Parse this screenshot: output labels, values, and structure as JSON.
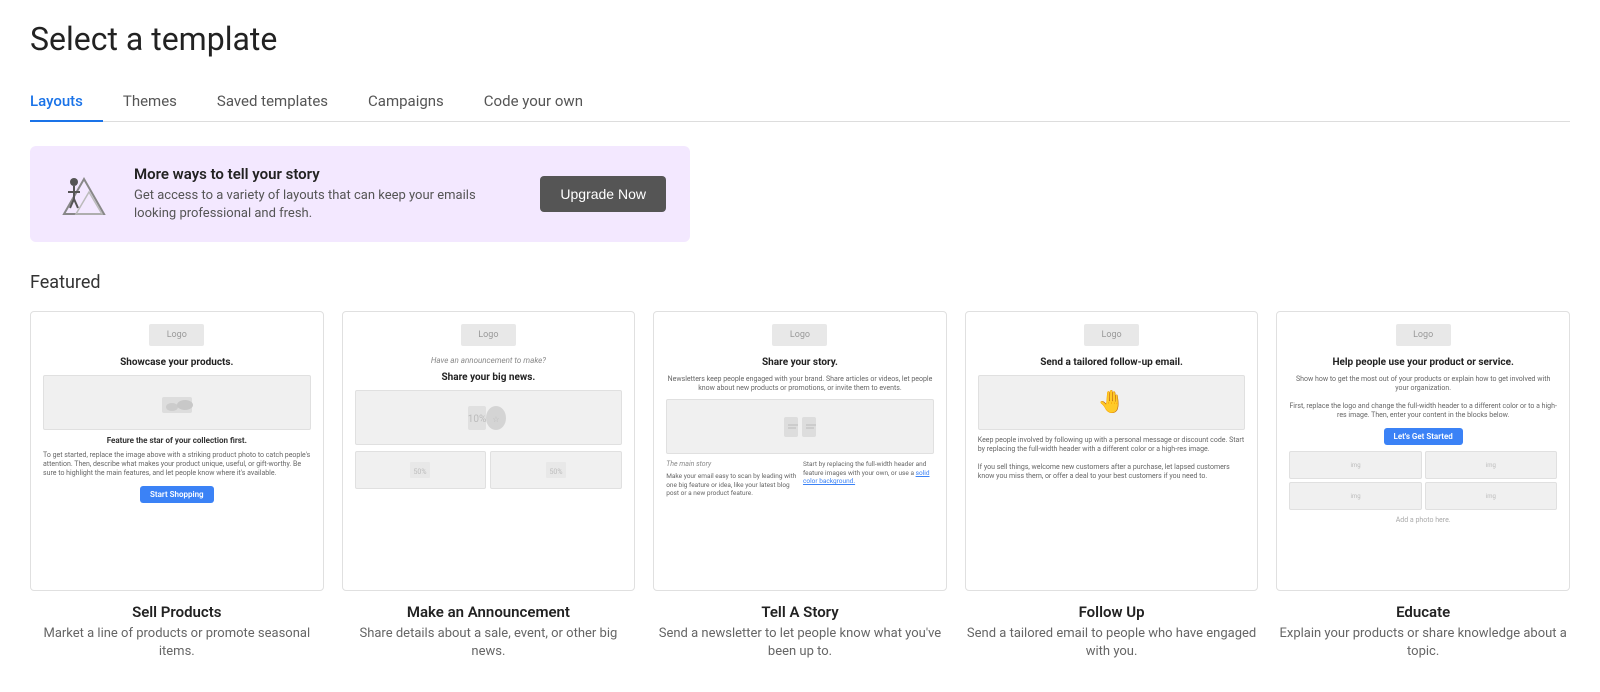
{
  "page": {
    "title": "Select a template"
  },
  "tabs": [
    {
      "id": "layouts",
      "label": "Layouts",
      "active": true
    },
    {
      "id": "themes",
      "label": "Themes",
      "active": false
    },
    {
      "id": "saved-templates",
      "label": "Saved templates",
      "active": false
    },
    {
      "id": "campaigns",
      "label": "Campaigns",
      "active": false
    },
    {
      "id": "code-your-own",
      "label": "Code your own",
      "active": false
    }
  ],
  "banner": {
    "title": "More ways to tell your story",
    "description": "Get access to a variety of layouts that can keep your emails looking professional and fresh.",
    "button_label": "Upgrade Now"
  },
  "featured_section": {
    "label": "Featured"
  },
  "templates": [
    {
      "id": "sell-products",
      "name": "Sell Products",
      "description": "Market a line of products or promote seasonal items.",
      "preview_headline": "Showcase your products.",
      "preview_subtext": "Feature the star of your collection first.",
      "preview_body": "To get started, replace the image above with a striking product photo to catch people's attention. Then, describe what makes your product unique, useful, or gift-worthy.",
      "preview_btn_label": "Start Shopping",
      "preview_btn_color": "#3b82f6"
    },
    {
      "id": "make-announcement",
      "name": "Make an Announcement",
      "description": "Share details about a sale, event, or other big news.",
      "preview_headline": "Share your big news.",
      "preview_sub": "Have an announcement to make?",
      "preview_btn_color": "#6366f1"
    },
    {
      "id": "tell-a-story",
      "name": "Tell A Story",
      "description": "Send a newsletter to let people know what you've been up to.",
      "preview_headline": "Share your story.",
      "preview_subtext": "Newsletters keep people engaged with your brand. Share articles or videos, let people know about new products or promotions, or invite them to events.",
      "preview_btn_color": "#3b82f6"
    },
    {
      "id": "follow-up",
      "name": "Follow Up",
      "description": "Send a tailored email to people who have engaged with you.",
      "preview_headline": "Send a tailored follow-up email.",
      "preview_body": "Keep people involved by following up with a personal message or discount code.",
      "preview_btn_color": "#3b82f6"
    },
    {
      "id": "educate",
      "name": "Educate",
      "description": "Explain your products or share knowledge about a topic.",
      "preview_headline": "Help people use your product or service.",
      "preview_body": "Show how to get the most out of your products or explain how to get involved with your organization.",
      "preview_btn_label": "Let's Get Started",
      "preview_btn_color": "#3b82f6"
    }
  ]
}
